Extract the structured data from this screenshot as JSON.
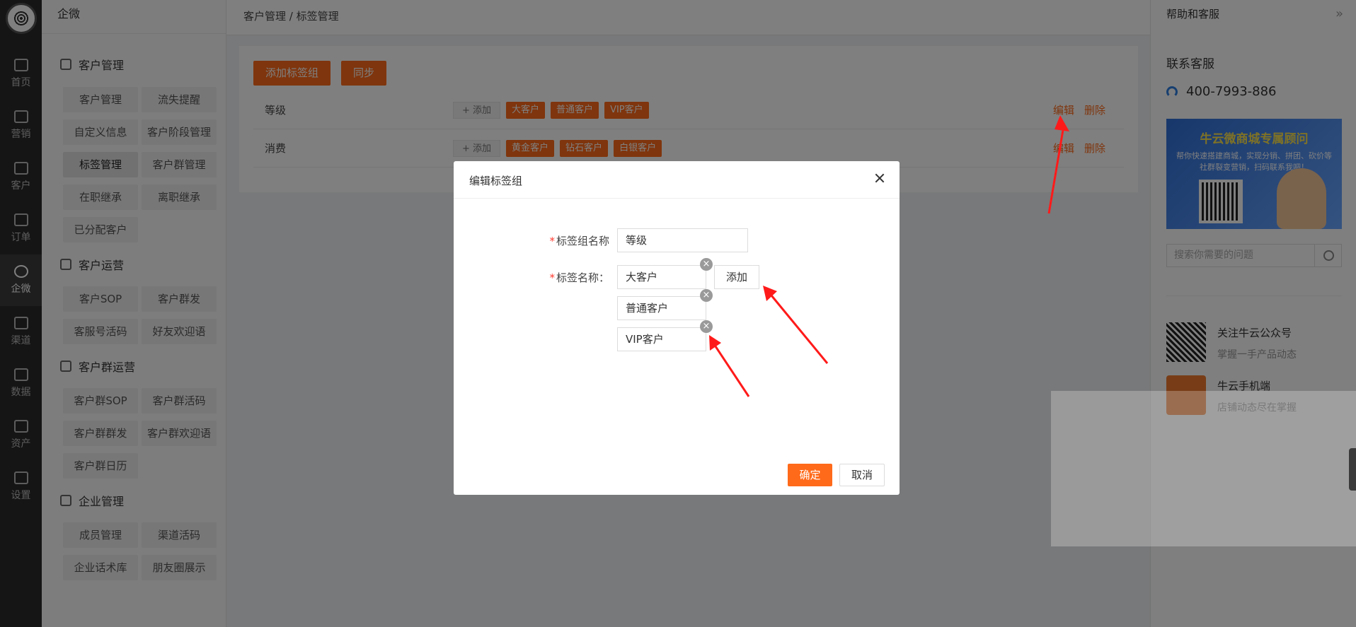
{
  "app": {
    "section_title": "企微"
  },
  "rail": {
    "items": [
      {
        "label": "首页",
        "icon": "home-icon"
      },
      {
        "label": "营销",
        "icon": "bag-icon"
      },
      {
        "label": "客户",
        "icon": "user-icon"
      },
      {
        "label": "订单",
        "icon": "order-icon"
      },
      {
        "label": "企微",
        "icon": "chat-icon"
      },
      {
        "label": "渠道",
        "icon": "channel-icon"
      },
      {
        "label": "数据",
        "icon": "data-icon"
      },
      {
        "label": "资产",
        "icon": "asset-icon"
      },
      {
        "label": "设置",
        "icon": "settings-icon"
      }
    ],
    "active": "企微"
  },
  "sidebar": {
    "groups": [
      {
        "title": "客户管理",
        "icon": "contact-icon",
        "items": [
          "客户管理",
          "流失提醒",
          "自定义信息",
          "客户阶段管理",
          "标签管理",
          "客户群管理",
          "在职继承",
          "离职继承",
          "已分配客户"
        ]
      },
      {
        "title": "客户运营",
        "icon": "user-ops-icon",
        "items": [
          "客户SOP",
          "客户群发",
          "客服号活码",
          "好友欢迎语"
        ]
      },
      {
        "title": "客户群运营",
        "icon": "group-icon",
        "items": [
          "客户群SOP",
          "客户群活码",
          "客户群群发",
          "客户群欢迎语",
          "客户群日历"
        ]
      },
      {
        "title": "企业管理",
        "icon": "enterprise-icon",
        "items": [
          "成员管理",
          "渠道活码",
          "企业话术库",
          "朋友圈展示"
        ]
      }
    ],
    "active_item": "标签管理"
  },
  "breadcrumb": "客户管理 / 标签管理",
  "main": {
    "add_group_label": "添加标签组",
    "sync_label": "同步",
    "add_tag_label": "+ 添加",
    "edit_label": "编辑",
    "delete_label": "删除",
    "tag_groups": [
      {
        "name": "等级",
        "tags": [
          "大客户",
          "普通客户",
          "VIP客户"
        ]
      },
      {
        "name": "消费",
        "tags": [
          "黄金客户",
          "钻石客户",
          "白银客户"
        ]
      }
    ]
  },
  "help": {
    "title": "帮助和客服",
    "collapse_icon": "double-chevron-right-icon",
    "contact_title": "联系客服",
    "phone": "400-7993-886",
    "banner_title": "牛云微商城专属顾问",
    "banner_subtitle": "帮你快速搭建商城，实现分销、拼团、砍价等社群裂变营销，扫码联系我吧！",
    "search_placeholder": "搜索你需要的问题",
    "feeds": [
      {
        "title": "关注牛云公众号",
        "subtitle": "掌握一手产品动态"
      },
      {
        "title": "牛云手机端",
        "subtitle": "店铺动态尽在掌握"
      }
    ]
  },
  "modal": {
    "title": "编辑标签组",
    "group_name_label": "标签组名称",
    "group_name_value": "等级",
    "tag_name_label": "标签名称：",
    "tags": [
      "大客户",
      "普通客户",
      "VIP客户"
    ],
    "add_label": "添加",
    "confirm_label": "确定",
    "cancel_label": "取消"
  },
  "colors": {
    "accent": "#ff6a1a",
    "required": "#ff3b30",
    "annotation": "#ff1a1a"
  }
}
